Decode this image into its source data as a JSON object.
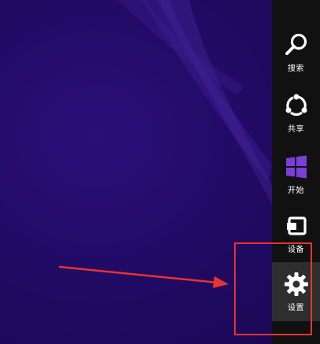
{
  "charms": [
    {
      "id": "search",
      "label": "搜索",
      "icon": "search-icon"
    },
    {
      "id": "share",
      "label": "共享",
      "icon": "share-icon"
    },
    {
      "id": "start",
      "label": "开始",
      "icon": "windows-logo-icon"
    },
    {
      "id": "devices",
      "label": "设备",
      "icon": "devices-icon"
    },
    {
      "id": "settings",
      "label": "设置",
      "icon": "gear-icon"
    }
  ],
  "colors": {
    "charm_bar": "#111111",
    "active_charm": "#2e2e2e",
    "start_logo": "#7a3fd8",
    "annotation": "#e8332f",
    "desktop": "#200a62"
  }
}
